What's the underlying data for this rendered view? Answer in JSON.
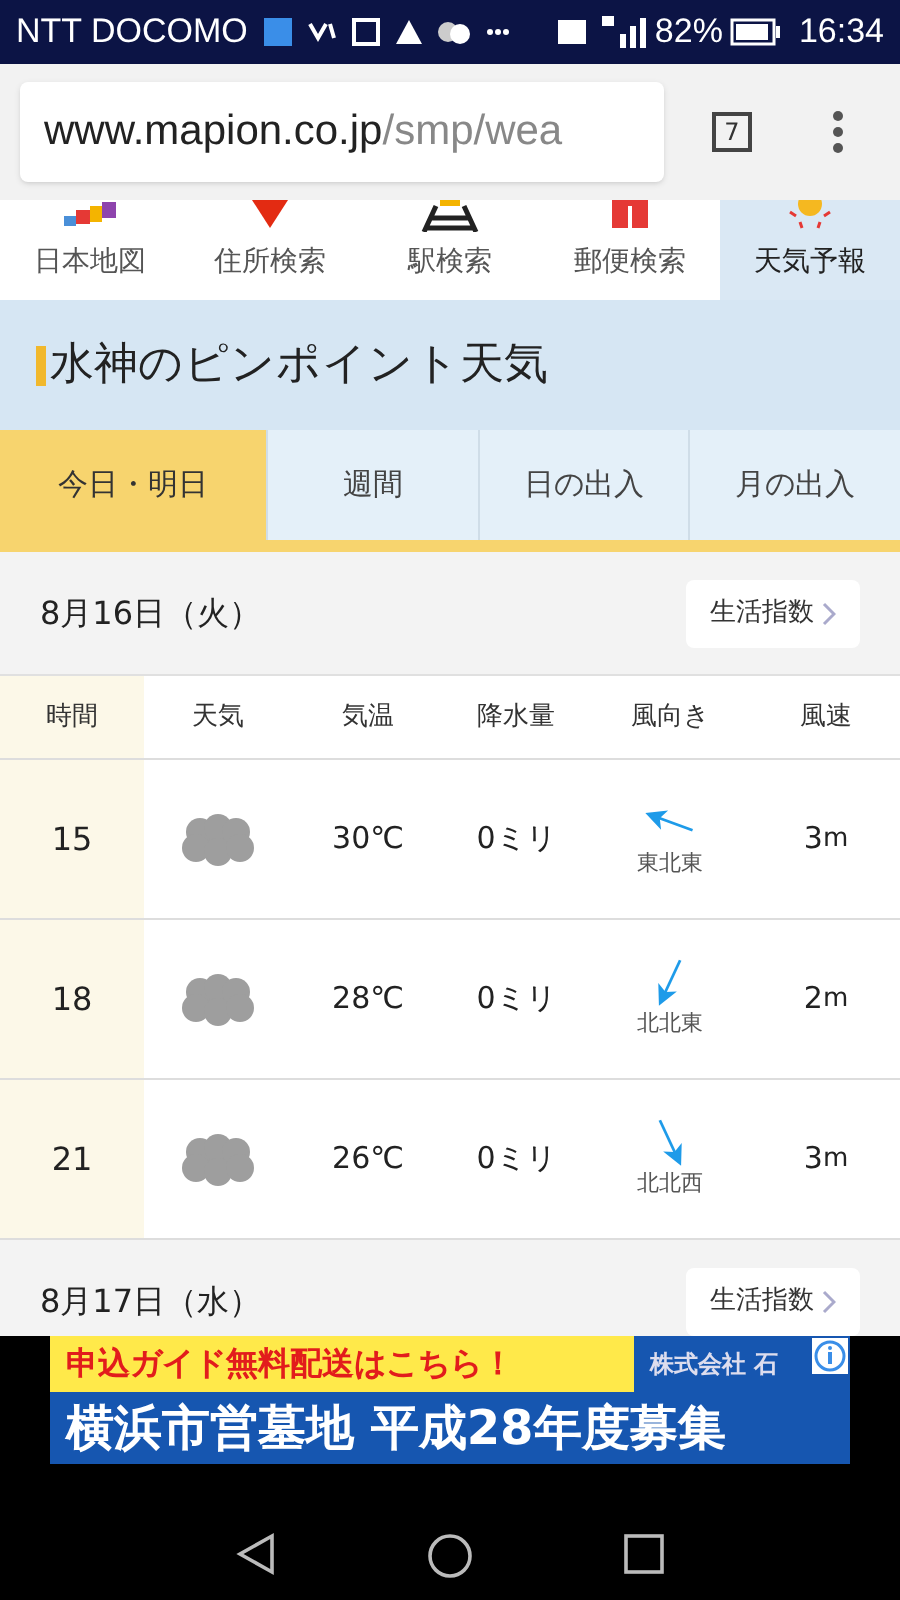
{
  "status_bar": {
    "carrier": "NTT DOCOMO",
    "battery": "82%",
    "time": "16:34"
  },
  "browser": {
    "url_host": "www.mapion.co.jp",
    "url_path": "/smp/wea",
    "tab_count": "7"
  },
  "site_nav": [
    {
      "label": "日本地図",
      "kind": "map",
      "selected": false
    },
    {
      "label": "住所検索",
      "kind": "pin",
      "selected": false
    },
    {
      "label": "駅検索",
      "kind": "rail",
      "selected": false
    },
    {
      "label": "郵便検索",
      "kind": "post",
      "selected": false
    },
    {
      "label": "天気予報",
      "kind": "sun",
      "selected": true
    }
  ],
  "page_title": "水神のピンポイント天気",
  "tabs": [
    {
      "label": "今日・明日",
      "selected": true
    },
    {
      "label": "週間",
      "selected": false
    },
    {
      "label": "日の出入",
      "selected": false
    },
    {
      "label": "月の出入",
      "selected": false
    }
  ],
  "days": [
    {
      "date": "8月16日（火）",
      "link": "生活指数",
      "columns": [
        "時間",
        "天気",
        "気温",
        "降水量",
        "風向き",
        "風速"
      ],
      "rows": [
        {
          "hour": "15",
          "weather": {
            "kind": "cloudy"
          },
          "temp": "30℃",
          "rain": "0ミリ",
          "wind": {
            "kind": "ene",
            "direction": "東北東"
          },
          "wind_speed": "3",
          "unit": "m"
        },
        {
          "hour": "18",
          "weather": {
            "kind": "cloudy"
          },
          "temp": "28℃",
          "rain": "0ミリ",
          "wind": {
            "kind": "nne",
            "direction": "北北東"
          },
          "wind_speed": "2",
          "unit": "m"
        },
        {
          "hour": "21",
          "weather": {
            "kind": "cloudy"
          },
          "temp": "26℃",
          "rain": "0ミリ",
          "wind": {
            "kind": "nnw",
            "direction": "北北西"
          },
          "wind_speed": "3",
          "unit": "m"
        }
      ]
    },
    {
      "date": "8月17日（水）",
      "link": "生活指数"
    }
  ],
  "ad": {
    "top": "申込ガイド無料配送はこちら！",
    "company": "株式会社 石",
    "main": "横浜市営墓地 平成28年度募集"
  }
}
